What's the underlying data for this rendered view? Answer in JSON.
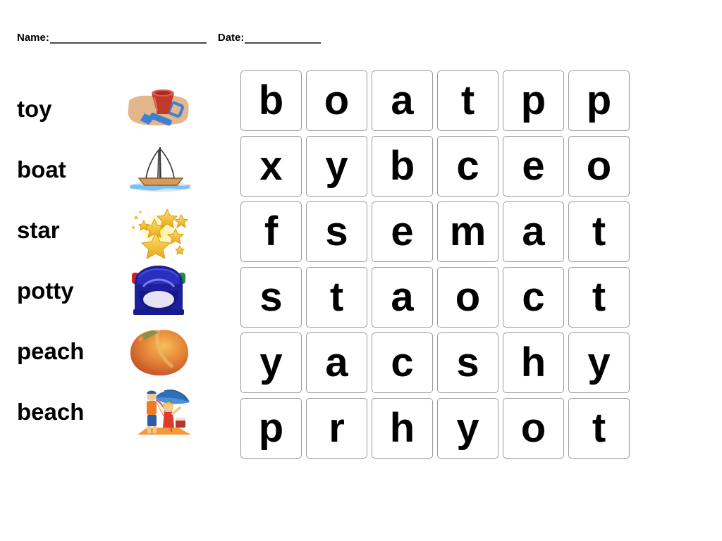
{
  "page": {
    "title": "Word Search Worksheet",
    "background_color": "#ffffff",
    "text_color": "#000000"
  },
  "header": {
    "name_label": "Name:",
    "date_label": "Date:",
    "rule_color": "#4a4a4a"
  },
  "word_list": {
    "items": [
      {
        "word": "toy",
        "picture": "bucket-and-spade-picture"
      },
      {
        "word": "boat",
        "picture": "sailboat-picture"
      },
      {
        "word": "star",
        "picture": "stars-picture"
      },
      {
        "word": "potty",
        "picture": "potty-picture"
      },
      {
        "word": "peach",
        "picture": "peach-picture"
      },
      {
        "word": "beach",
        "picture": "beach-scene-picture"
      }
    ]
  },
  "grid": {
    "rows": 6,
    "columns": 6,
    "border_color": "#9a9a9a",
    "letters": [
      [
        "b",
        "o",
        "a",
        "t",
        "p",
        "p"
      ],
      [
        "x",
        "y",
        "b",
        "c",
        "e",
        "o"
      ],
      [
        "f",
        "s",
        "e",
        "m",
        "a",
        "t"
      ],
      [
        "s",
        "t",
        "a",
        "o",
        "c",
        "t"
      ],
      [
        "y",
        "a",
        "c",
        "s",
        "h",
        "y"
      ],
      [
        "p",
        "r",
        "h",
        "y",
        "o",
        "t"
      ]
    ]
  }
}
